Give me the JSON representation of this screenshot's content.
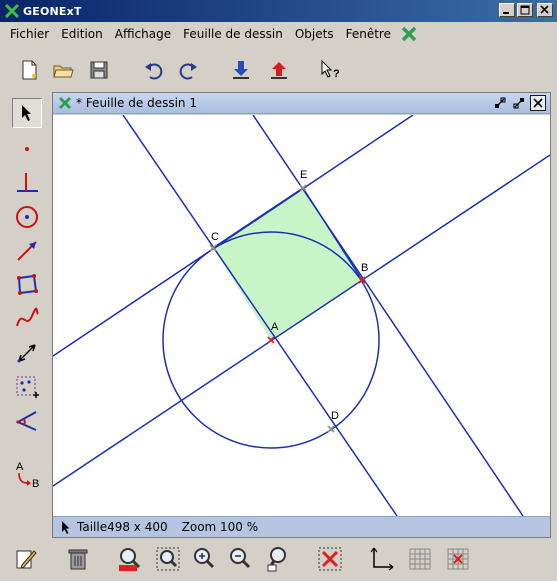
{
  "window": {
    "title": "GEONExT"
  },
  "menu": [
    "Fichier",
    "Edition",
    "Affichage",
    "Feuille de dessin",
    "Objets",
    "Fenêtre"
  ],
  "toolbar": {
    "icons": [
      "new-file-icon",
      "open-folder-icon",
      "save-icon",
      "undo-icon",
      "redo-icon",
      "download-icon",
      "upload-icon",
      "help-pointer-icon"
    ]
  },
  "left_tools": [
    "select-arrow-icon",
    "point-icon",
    "perpendicular-icon",
    "circle-icon",
    "line-icon",
    "polygon-icon",
    "curve-icon",
    "measure-icon",
    "group-icon",
    "angle-icon",
    "rename-icon"
  ],
  "sheet": {
    "title": "* Feuille de dessin 1"
  },
  "status": {
    "size_label": "Taille498 x 400",
    "zoom_label": "Zoom 100 %"
  },
  "labels": {
    "A": "A",
    "B": "B",
    "C": "C",
    "D": "D",
    "E": "E",
    "left_tool_A": "A",
    "left_tool_B": "B"
  },
  "colors": {
    "line": "#1a2fb3",
    "fill": "#c8f5c8",
    "point_free": "#e02020",
    "point_dep": "#909090",
    "title_start": "#0a246a",
    "title_end": "#3a6ea5"
  },
  "bottom_toolbar": {
    "icons": [
      "edit-icon",
      "trash-icon",
      "zoom-100-icon",
      "zoom-fit-icon",
      "zoom-in-icon",
      "zoom-out-icon",
      "zoom-search-icon",
      "delete-all-icon",
      "axes-icon",
      "grid-icon",
      "snap-grid-icon"
    ]
  }
}
